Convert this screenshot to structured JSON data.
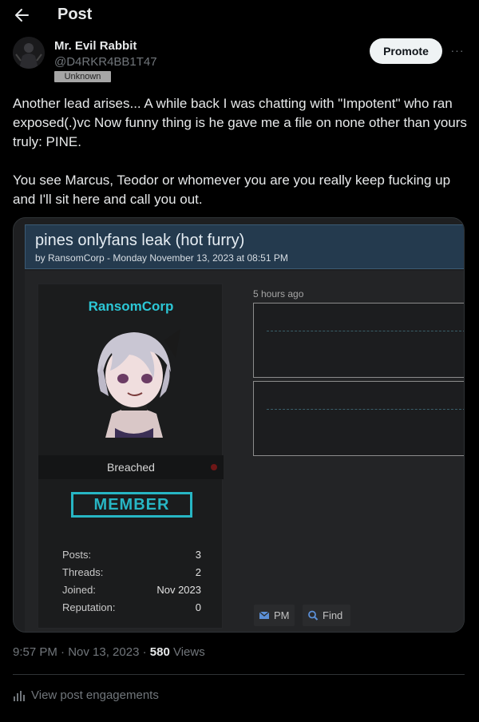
{
  "header": {
    "title": "Post",
    "back_icon": "arrow-left-icon"
  },
  "author": {
    "name": "Mr. Evil Rabbit",
    "handle": "@D4RKR4BB1T47",
    "badge": "Unknown"
  },
  "actions": {
    "promote_label": "Promote",
    "more_label": "···"
  },
  "post": {
    "text_para1": "Another lead arises... A while back I was chatting with \"Impotent\" who ran exposed(.)vc Now funny thing is he gave me a file on none other than yours truly: PINE.",
    "text_para2": "You see Marcus, Teodor or whomever you are you really keep fucking up and I'll sit here and call you out."
  },
  "media": {
    "thread_title": "pines onlyfans leak (hot furry)",
    "thread_meta": "by RansomCorp - Monday November 13, 2023 at 08:51 PM",
    "username": "RansomCorp",
    "status": "Breached",
    "rank": "MEMBER",
    "stats": [
      {
        "label": "Posts:",
        "value": "3"
      },
      {
        "label": "Threads:",
        "value": "2"
      },
      {
        "label": "Joined:",
        "value": "Nov 2023"
      },
      {
        "label": "Reputation:",
        "value": "0"
      }
    ],
    "post_age": "5 hours ago",
    "pm_label": "PM",
    "find_label": "Find"
  },
  "footer": {
    "time": "9:57 PM · Nov 13, 2023 · ",
    "views_count": "580",
    "views_label": " Views",
    "engagements_label": "View post engagements"
  },
  "colors": {
    "background": "#000000",
    "text": "#e7e9ea",
    "muted": "#71767b",
    "accent_cyan": "#2cc7d6",
    "forum_header": "#243a4e"
  }
}
